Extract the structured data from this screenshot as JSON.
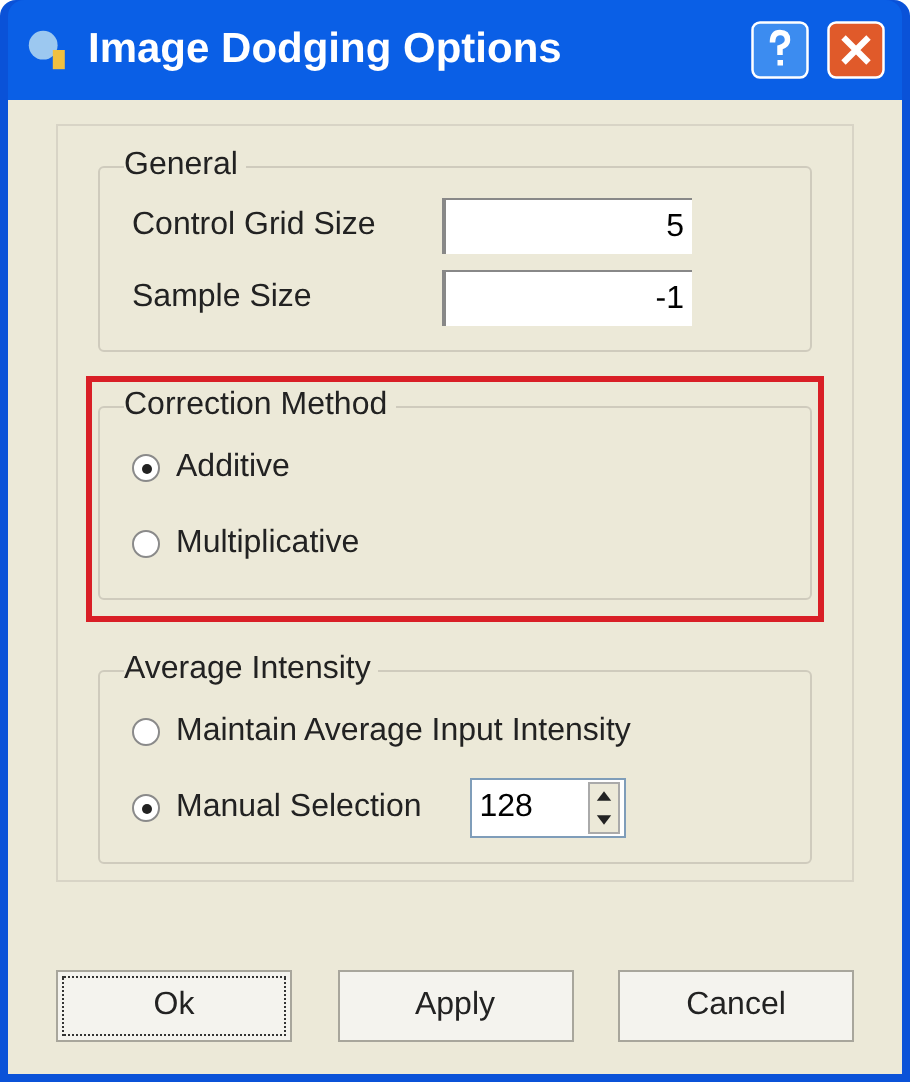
{
  "window": {
    "title": "Image Dodging Options"
  },
  "general": {
    "title": "General",
    "fields": [
      {
        "label": "Control Grid Size",
        "value": "5"
      },
      {
        "label": "Sample Size",
        "value": "-1"
      }
    ]
  },
  "correction_method": {
    "title": "Correction Method",
    "highlighted": true,
    "options": [
      {
        "kind": "radio",
        "label": "Additive",
        "selected": true
      },
      {
        "kind": "radio",
        "label": "Multiplicative",
        "selected": false
      }
    ]
  },
  "average_intensity": {
    "title": "Average Intensity",
    "highlighted": false,
    "options": [
      {
        "kind": "radio",
        "label": "Maintain Average Input Intensity",
        "selected": false
      },
      {
        "kind": "radio_spin",
        "label": "Manual Selection",
        "selected": true,
        "value": "128"
      }
    ]
  },
  "buttons": [
    {
      "label": "Ok",
      "focused": true
    },
    {
      "label": "Apply",
      "focused": false
    },
    {
      "label": "Cancel",
      "focused": false
    }
  ]
}
